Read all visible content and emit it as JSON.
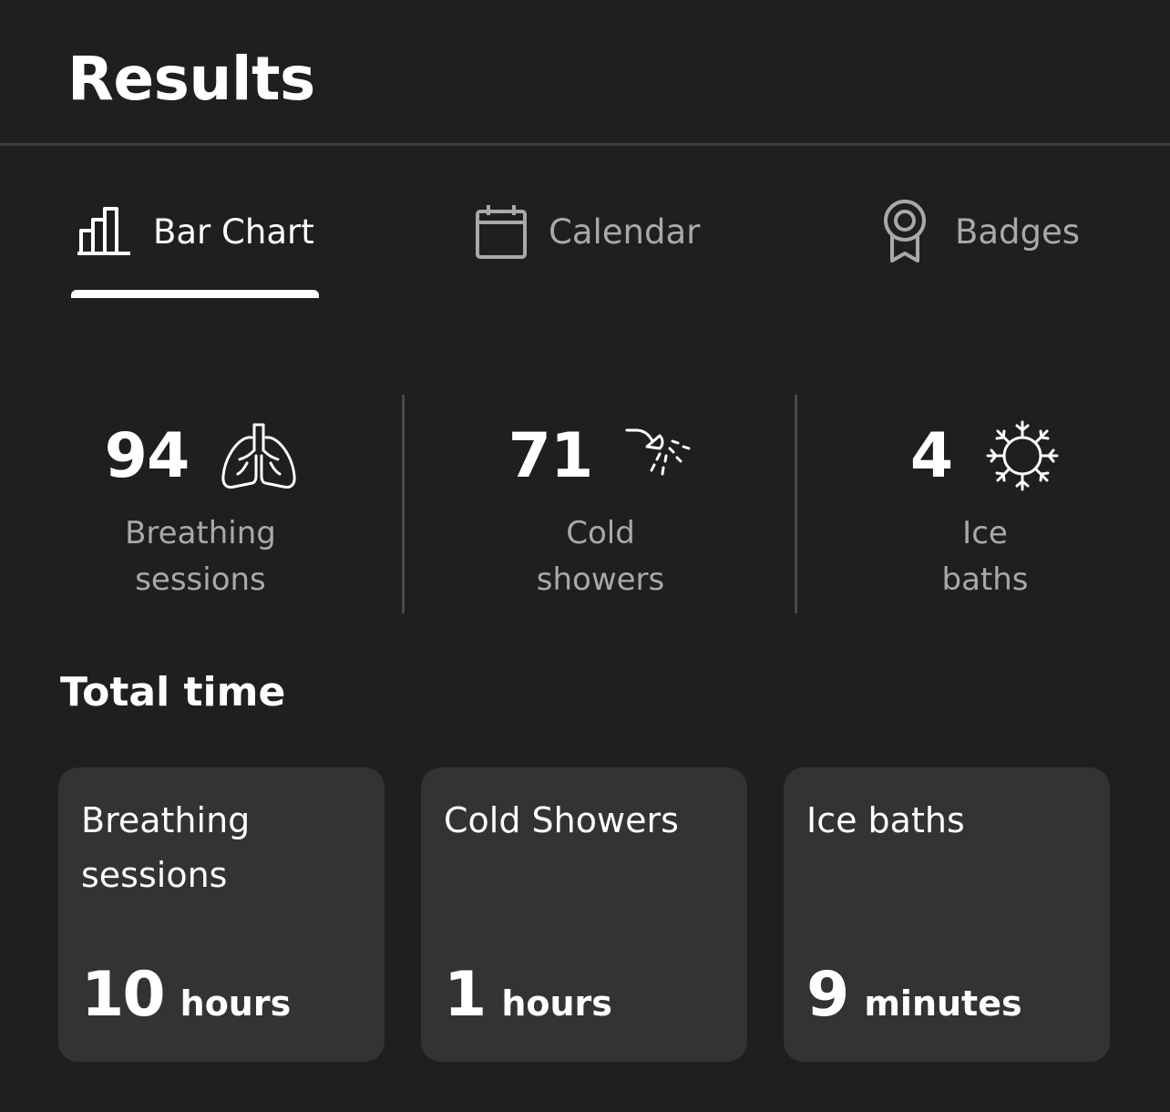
{
  "header": {
    "title": "Results"
  },
  "tabs": [
    {
      "label": "Bar Chart",
      "icon": "bar-chart-icon",
      "active": true
    },
    {
      "label": "Calendar",
      "icon": "calendar-icon",
      "active": false
    },
    {
      "label": "Badges",
      "icon": "badge-icon",
      "active": false
    }
  ],
  "stats": [
    {
      "value": "94",
      "label_line1": "Breathing",
      "label_line2": "sessions",
      "icon": "lungs-icon"
    },
    {
      "value": "71",
      "label_line1": "Cold",
      "label_line2": "showers",
      "icon": "shower-icon"
    },
    {
      "value": "4",
      "label_line1": "Ice",
      "label_line2": "baths",
      "icon": "snowflake-icon"
    }
  ],
  "total_time": {
    "title": "Total time",
    "cards": [
      {
        "title": "Breathing sessions",
        "value": "10",
        "unit": "hours"
      },
      {
        "title": "Cold Showers",
        "value": "1",
        "unit": "hours"
      },
      {
        "title": "Ice baths",
        "value": "9",
        "unit": "minutes"
      }
    ]
  },
  "colors": {
    "background": "#1f1f1f",
    "card": "#333333",
    "muted_text": "#a9a9a9",
    "active": "#ffffff"
  }
}
